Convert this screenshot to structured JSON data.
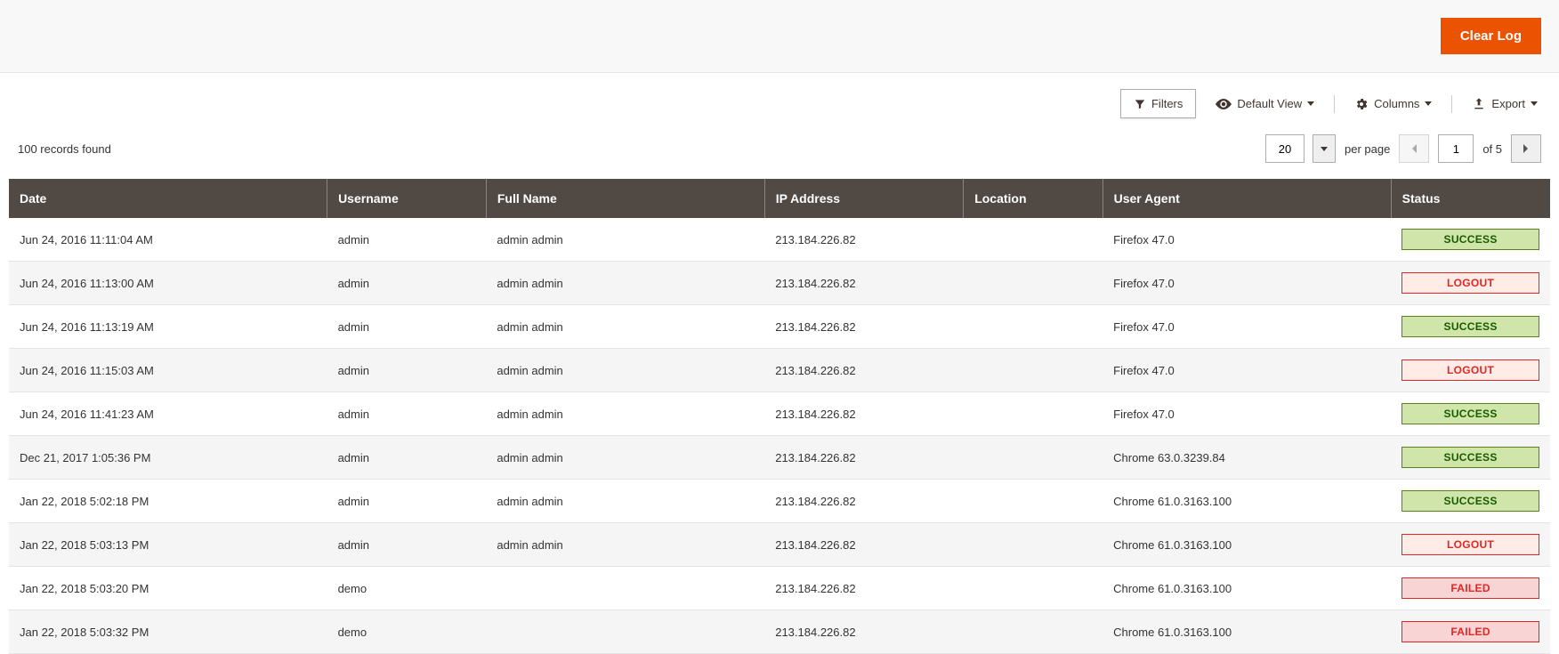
{
  "actions": {
    "clear_log": "Clear Log"
  },
  "toolbar": {
    "filters": "Filters",
    "default_view": "Default View",
    "columns": "Columns",
    "export": "Export"
  },
  "pager": {
    "records_found": "100 records found",
    "page_size": "20",
    "per_page": "per page",
    "current_page": "1",
    "of_total": "of 5"
  },
  "table": {
    "headers": {
      "date": "Date",
      "username": "Username",
      "full_name": "Full Name",
      "ip": "IP Address",
      "location": "Location",
      "user_agent": "User Agent",
      "status": "Status"
    },
    "rows": [
      {
        "date": "Jun 24, 2016 11:11:04 AM",
        "username": "admin",
        "full_name": "admin admin",
        "ip": "213.184.226.82",
        "location": "",
        "user_agent": "Firefox 47.0",
        "status": "SUCCESS"
      },
      {
        "date": "Jun 24, 2016 11:13:00 AM",
        "username": "admin",
        "full_name": "admin admin",
        "ip": "213.184.226.82",
        "location": "",
        "user_agent": "Firefox 47.0",
        "status": "LOGOUT"
      },
      {
        "date": "Jun 24, 2016 11:13:19 AM",
        "username": "admin",
        "full_name": "admin admin",
        "ip": "213.184.226.82",
        "location": "",
        "user_agent": "Firefox 47.0",
        "status": "SUCCESS"
      },
      {
        "date": "Jun 24, 2016 11:15:03 AM",
        "username": "admin",
        "full_name": "admin admin",
        "ip": "213.184.226.82",
        "location": "",
        "user_agent": "Firefox 47.0",
        "status": "LOGOUT"
      },
      {
        "date": "Jun 24, 2016 11:41:23 AM",
        "username": "admin",
        "full_name": "admin admin",
        "ip": "213.184.226.82",
        "location": "",
        "user_agent": "Firefox 47.0",
        "status": "SUCCESS"
      },
      {
        "date": "Dec 21, 2017 1:05:36 PM",
        "username": "admin",
        "full_name": "admin admin",
        "ip": "213.184.226.82",
        "location": "",
        "user_agent": "Chrome 63.0.3239.84",
        "status": "SUCCESS"
      },
      {
        "date": "Jan 22, 2018 5:02:18 PM",
        "username": "admin",
        "full_name": "admin admin",
        "ip": "213.184.226.82",
        "location": "",
        "user_agent": "Chrome 61.0.3163.100",
        "status": "SUCCESS"
      },
      {
        "date": "Jan 22, 2018 5:03:13 PM",
        "username": "admin",
        "full_name": "admin admin",
        "ip": "213.184.226.82",
        "location": "",
        "user_agent": "Chrome 61.0.3163.100",
        "status": "LOGOUT"
      },
      {
        "date": "Jan 22, 2018 5:03:20 PM",
        "username": "demo",
        "full_name": "",
        "ip": "213.184.226.82",
        "location": "",
        "user_agent": "Chrome 61.0.3163.100",
        "status": "FAILED"
      },
      {
        "date": "Jan 22, 2018 5:03:32 PM",
        "username": "demo",
        "full_name": "",
        "ip": "213.184.226.82",
        "location": "",
        "user_agent": "Chrome 61.0.3163.100",
        "status": "FAILED"
      }
    ]
  }
}
